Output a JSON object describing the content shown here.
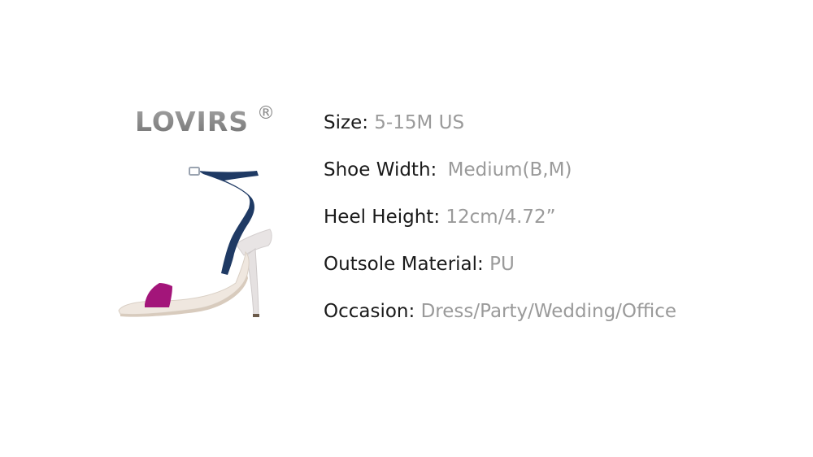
{
  "brand": {
    "name": "LOVIRS",
    "mark": "®"
  },
  "product_image": {
    "description_icon": "high-heel-sandal-icon",
    "colors": {
      "toe_strap": "#a3157a",
      "ankle_strap": "#1f3a64",
      "sole": "#eae3dc",
      "heel": "#e9e6e6"
    }
  },
  "specs": [
    {
      "label": "Size:",
      "value": "5-15M US"
    },
    {
      "label": "Shoe Width:",
      "value": "Medium(B,M)"
    },
    {
      "label": "Heel Height:",
      "value": "12cm/4.72”"
    },
    {
      "label": "Outsole Material:",
      "value": "PU"
    },
    {
      "label": "Occasion:",
      "value": "Dress/Party/Wedding/Office"
    }
  ]
}
